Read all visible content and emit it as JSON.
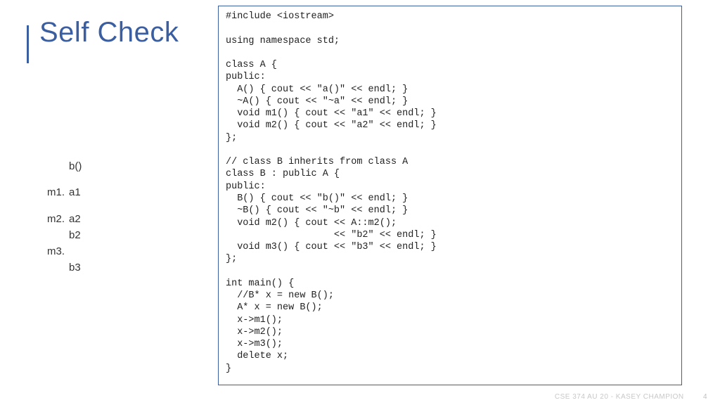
{
  "title": "Self Check",
  "notes": [
    {
      "label": "",
      "val": "b()"
    },
    {
      "label": "m1.",
      "val": "a1"
    },
    {
      "label": "m2.",
      "val": "a2"
    },
    {
      "label": "",
      "val": "b2"
    },
    {
      "label": "m3.",
      "val": ""
    },
    {
      "label": "",
      "val": "b3"
    }
  ],
  "code": "#include <iostream>\n\nusing namespace std;\n\nclass A {\npublic:\n  A() { cout << \"a()\" << endl; }\n  ~A() { cout << \"~a\" << endl; }\n  void m1() { cout << \"a1\" << endl; }\n  void m2() { cout << \"a2\" << endl; }\n};\n\n// class B inherits from class A\nclass B : public A {\npublic:\n  B() { cout << \"b()\" << endl; }\n  ~B() { cout << \"~b\" << endl; }\n  void m2() { cout << A::m2();\n                   << \"b2\" << endl; }\n  void m3() { cout << \"b3\" << endl; }\n};\n\nint main() {\n  //B* x = new B();\n  A* x = new B();\n  x->m1();\n  x->m2();\n  x->m3();\n  delete x;\n}",
  "footer": {
    "course": "CSE 374 AU 20 - KASEY CHAMPION",
    "page": "4"
  }
}
